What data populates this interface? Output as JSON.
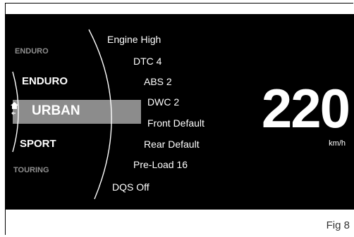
{
  "modes": {
    "above2": "ENDURO",
    "above1": "ENDURO",
    "selected": "URBAN",
    "below1": "SPORT",
    "below2": "TOURING"
  },
  "settings": [
    "Engine High",
    "DTC 4",
    "ABS 2",
    "DWC 2",
    "Front Default",
    "Rear Default",
    "Pre-Load 16",
    "DQS Off"
  ],
  "speed": {
    "value": "220",
    "unit": "km/h"
  },
  "figure_label": "Fig 8",
  "colors": {
    "screen": "#000000",
    "selection_bar": "#8c8c8c",
    "text": "#ffffff",
    "inactive_text": "#8f8f8f"
  },
  "icons": {
    "selected_mode_marker": "home-arrow-icon"
  }
}
